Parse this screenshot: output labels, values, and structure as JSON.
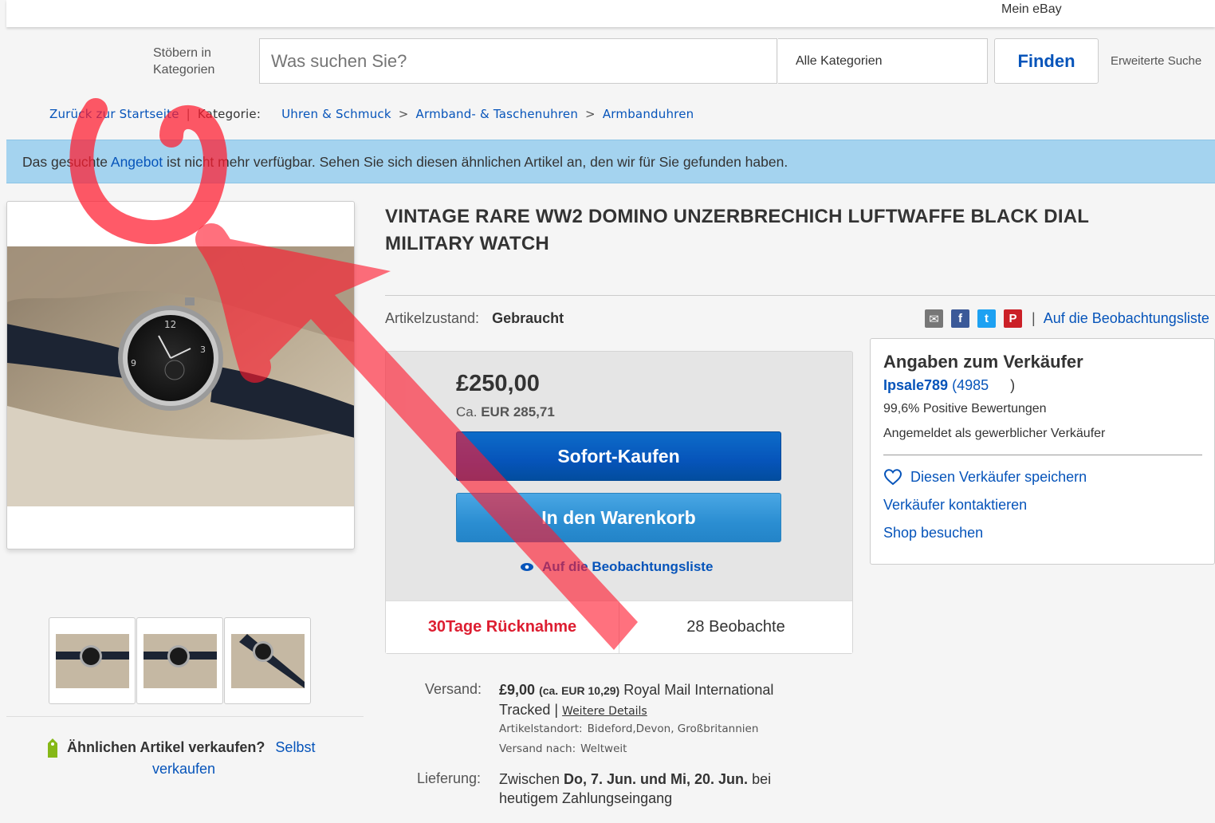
{
  "header": {
    "my_ebay": "Mein eBay"
  },
  "search": {
    "browse_label": "Stöbern in Kategorien",
    "placeholder": "Was suchen Sie?",
    "category": "Alle Kategorien",
    "find_button": "Finden",
    "advanced": "Erweiterte Suche"
  },
  "breadcrumb": {
    "back": "Zurück zur Startseite",
    "category_label": "Kategorie:",
    "items": [
      "Uhren & Schmuck",
      "Armband- & Taschenuhren",
      "Armbanduhren"
    ]
  },
  "notice": {
    "prefix": "Das gesuchte ",
    "link": "Angebot",
    "suffix": " ist nicht mehr verfügbar. Sehen Sie sich diesen ähnlichen Artikel an, den wir für Sie gefunden haben."
  },
  "item": {
    "title": "VINTAGE RARE WW2 DOMINO UNZERBRECHICH LUFTWAFFE BLACK DIAL MILITARY WATCH",
    "condition_label": "Artikelzustand:",
    "condition": "Gebraucht",
    "watchlist_link": "Auf die Beobachtungsliste"
  },
  "buybox": {
    "price": "£250,00",
    "approx_prefix": "Ca.",
    "approx_value": "EUR 285,71",
    "buy_now": "Sofort-Kaufen",
    "add_to_cart": "In den Warenkorb",
    "watch": "Auf die Beobachtungsliste",
    "returns": "30Tage Rücknahme",
    "watchers": "28 Beobachte"
  },
  "seller": {
    "heading": "Angaben zum Verkäufer",
    "name": "Ipsale789",
    "feedback_count": "(4985",
    "feedback_close": ")",
    "positive": "99,6% Positive Bewertungen",
    "business": "Angemeldet als gewerblicher Verkäufer",
    "save": "Diesen Verkäufer speichern",
    "contact": "Verkäufer kontaktieren",
    "shop": "Shop besuchen"
  },
  "shipping": {
    "label": "Versand:",
    "price": "£9,00",
    "approx": "(ca. EUR 10,29)",
    "service": "Royal Mail International Tracked |",
    "details": "Weitere Details",
    "location_label": "Artikelstandort:",
    "location": "Bideford,Devon, Großbritannien",
    "ships_to_label": "Versand nach:",
    "ships_to": "Weltweit"
  },
  "delivery": {
    "label": "Lieferung:",
    "p1": "Zwischen ",
    "dates": "Do, 7. Jun. und Mi, 20. Jun.",
    "p2": " bei heutigem Zahlungseingang"
  },
  "sell_similar": {
    "question": "Ähnlichen Artikel verkaufen?",
    "link1": "Selbst",
    "link2": "verkaufen"
  },
  "colors": {
    "link": "#0654ba",
    "notice_bg": "#a4d3ef",
    "returns": "#dd1e31",
    "annotation": "#ff1a2e"
  }
}
